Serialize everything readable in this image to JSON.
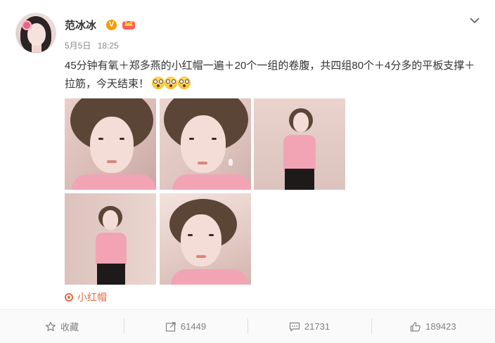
{
  "post": {
    "username": "范冰冰",
    "verified_badge": "V",
    "date": "5月5日",
    "time": "18:25",
    "text": "45分钟有氧＋郑多燕的小红帽一遍＋20个一组的卷腹，共四组80个＋4分多的平板支撑＋拉筋，今天结束！",
    "emojis": [
      "dizzy-face",
      "dizzy-face",
      "dizzy-face"
    ],
    "photo_count": 5,
    "topic": "小红帽"
  },
  "actions": {
    "favorite_label": "收藏",
    "repost_count": "61449",
    "comment_count": "21731",
    "like_count": "189423"
  },
  "colors": {
    "accent": "#e66b46",
    "badge": "#f79b00",
    "text": "#333333",
    "muted": "#808080",
    "shirt": "#f2a4b4"
  },
  "icons": [
    "chevron-down-icon",
    "crown-icon",
    "topic-pin-icon",
    "star-icon",
    "repost-icon",
    "comment-icon",
    "like-icon"
  ]
}
